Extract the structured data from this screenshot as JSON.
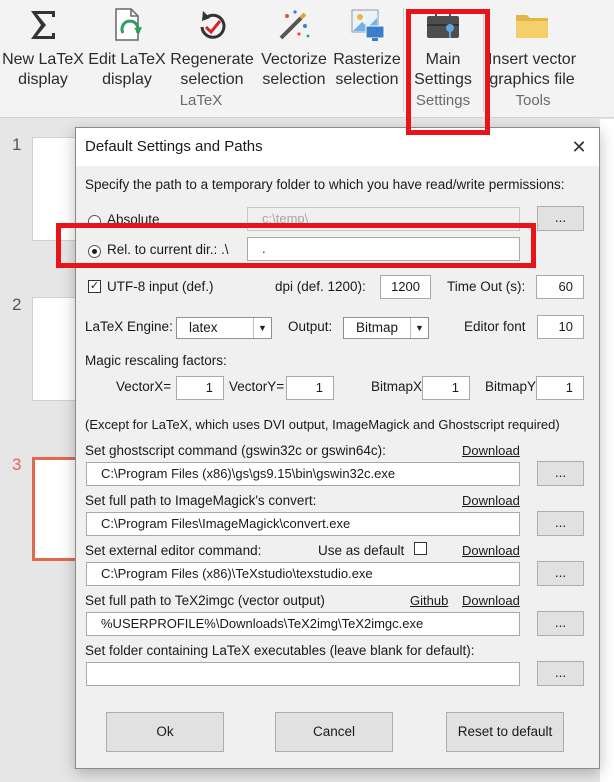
{
  "ribbon": {
    "buttons": [
      {
        "label": "New LaTeX\ndisplay",
        "icon": "sigma-icon"
      },
      {
        "label": "Edit LaTeX\ndisplay",
        "icon": "edit-document-icon"
      },
      {
        "label": "Regenerate\nselection",
        "icon": "regenerate-icon"
      },
      {
        "label": "Vectorize\nselection",
        "icon": "vectorize-icon"
      },
      {
        "label": "Rasterize\nselection",
        "icon": "rasterize-icon"
      },
      {
        "label": "Main\nSettings",
        "icon": "toolbox-icon"
      },
      {
        "label": "Insert vector\ngraphics file",
        "icon": "folder-icon"
      }
    ],
    "groups": [
      "LaTeX",
      "Settings",
      "Tools"
    ]
  },
  "slides": {
    "numbers": [
      "1",
      "2",
      "3"
    ],
    "current": "3"
  },
  "dialog": {
    "title": "Default Settings and Paths",
    "close_glyph": "✕",
    "temp_prompt": "Specify the path to a temporary folder to which you have read/write permissions:",
    "absolute_label": "Absolute",
    "absolute_value": "c:\\temp\\",
    "relative_label": "Rel. to current dir.: .\\",
    "relative_value": ".",
    "browse_label": "...",
    "utf8_label": "UTF-8 input (def.)",
    "utf8_checked": true,
    "dpi_label": "dpi (def. 1200):",
    "dpi_value": "1200",
    "timeout_label": "Time Out (s):",
    "timeout_value": "60",
    "engine_label": "LaTeX Engine:",
    "engine_value": "latex",
    "output_label": "Output:",
    "output_value": "Bitmap",
    "editor_font_label": "Editor font",
    "editor_font_value": "10",
    "magic_label": "Magic rescaling factors:",
    "vectorx_label": "VectorX=",
    "vectorx_value": "1",
    "vectory_label": "VectorY=",
    "vectory_value": "1",
    "bitmapx_label": "BitmapX",
    "bitmapx_value": "1",
    "bitmapy_label": "BitmapY",
    "bitmapy_value": "1",
    "note": "(Except for LaTeX, which uses DVI output, ImageMagick and Ghostscript required)",
    "gs_label": "Set ghostscript command (gswin32c or gswin64c):",
    "gs_value": "C:\\Program Files (x86)\\gs\\gs9.15\\bin\\gswin32c.exe",
    "im_label": "Set full path to ImageMagick's convert:",
    "im_value": "C:\\Program Files\\ImageMagick\\convert.exe",
    "editor_label": "Set external editor command:",
    "use_default_label": "Use as default",
    "editor_value": "C:\\Program Files (x86)\\TeXstudio\\texstudio.exe",
    "tex2img_label": "Set full path to TeX2imgc (vector output)",
    "tex2img_value": "%USERPROFILE%\\Downloads\\TeX2img\\TeX2imgc.exe",
    "github_label": "Github",
    "download_label": "Download",
    "latex_folder_label": "Set folder containing LaTeX executables (leave blank for default):",
    "latex_folder_value": "",
    "ok_label": "Ok",
    "cancel_label": "Cancel",
    "reset_label": "Reset to default"
  },
  "colors": {
    "highlight": "#e8141c",
    "current_slide": "#e06a4e"
  }
}
